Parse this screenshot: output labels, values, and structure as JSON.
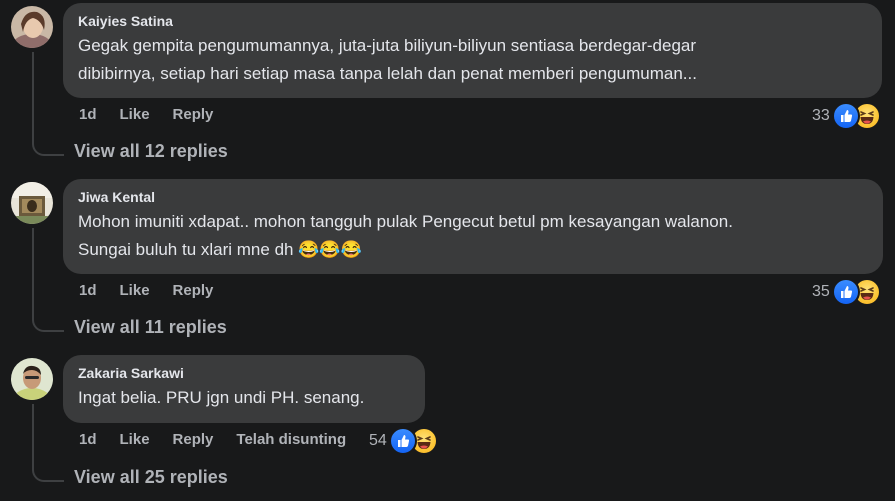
{
  "comments": [
    {
      "author": "Kaiyies Satina",
      "lines": [
        "Gegak gempita pengumumannya, juta-juta biliyun-biliyun sentiasa berdegar-degar",
        "dibibirnya, setiap hari setiap masa tanpa lelah dan penat memberi pengumuman..."
      ],
      "time": "1d",
      "like_label": "Like",
      "reply_label": "Reply",
      "reaction_count": "33",
      "view_replies": "View all 12 replies"
    },
    {
      "author": "Jiwa Kental",
      "lines": [
        "Mohon imuniti xdapat.. mohon tangguh pulak Pengecut betul pm kesayangan walanon.",
        "Sungai buluh tu xlari mne dh 😂😂😂"
      ],
      "time": "1d",
      "like_label": "Like",
      "reply_label": "Reply",
      "reaction_count": "35",
      "view_replies": "View all 11 replies"
    },
    {
      "author": "Zakaria Sarkawi",
      "lines": [
        "Ingat belia. PRU jgn undi PH. senang."
      ],
      "time": "1d",
      "like_label": "Like",
      "reply_label": "Reply",
      "edited_label": "Telah disunting",
      "reaction_count": "54",
      "view_replies": "View all 25 replies"
    }
  ],
  "colors": {
    "background": "#18191a",
    "bubble": "#3a3b3c",
    "text": "#e4e6eb",
    "muted": "#b0b3b8",
    "like_blue": "#1877f2",
    "haha_yellow": "#fcc534"
  },
  "icons": {
    "like": "thumbs-up-icon",
    "haha": "laughing-face-icon"
  }
}
